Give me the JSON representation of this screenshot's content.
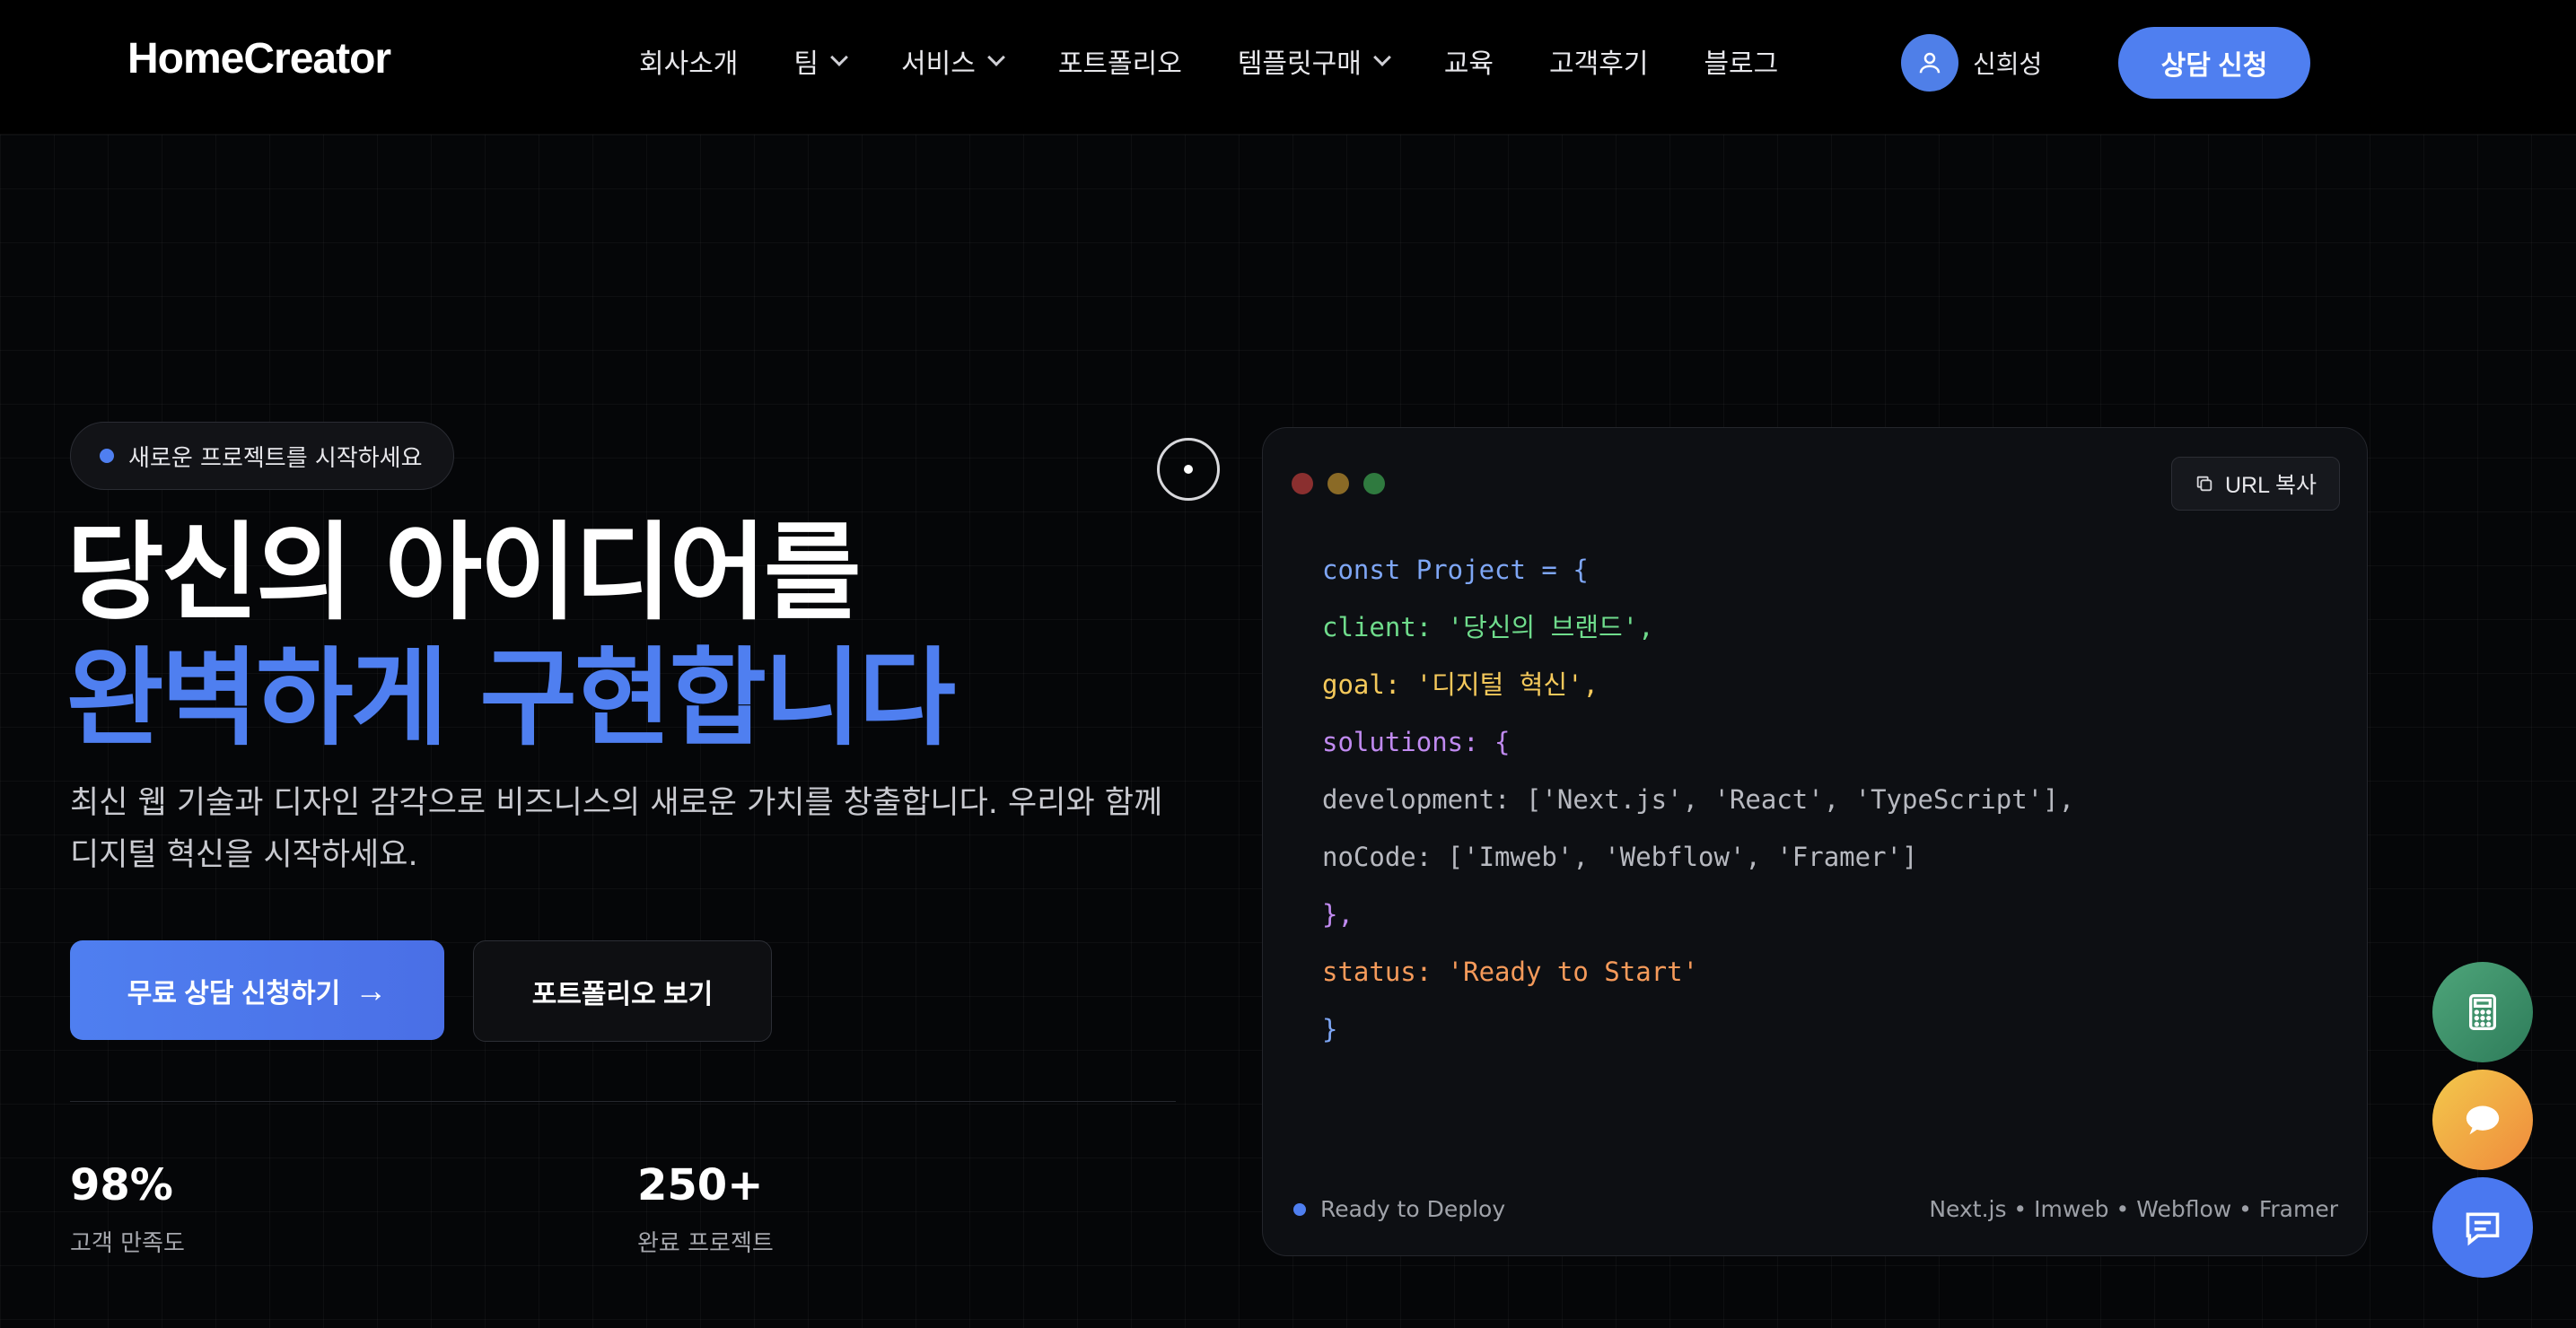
{
  "header": {
    "logo": "HomeCreator",
    "nav": [
      {
        "label": "회사소개",
        "dropdown": false
      },
      {
        "label": "팀",
        "dropdown": true
      },
      {
        "label": "서비스",
        "dropdown": true
      },
      {
        "label": "포트폴리오",
        "dropdown": false
      },
      {
        "label": "템플릿구매",
        "dropdown": true
      },
      {
        "label": "교육",
        "dropdown": false
      },
      {
        "label": "고객후기",
        "dropdown": false
      },
      {
        "label": "블로그",
        "dropdown": false
      }
    ],
    "user_name": "신희성",
    "cta": "상담 신청"
  },
  "hero": {
    "badge": "새로운 프로젝트를 시작하세요",
    "title_line1": "당신의 아이디어를",
    "title_line2": "완벽하게 구현합니다",
    "description": "최신 웹 기술과 디자인 감각으로 비즈니스의 새로운 가치를 창출합니다. 우리와 함께 디지털 혁신을 시작하세요.",
    "primary_button": "무료 상담 신청하기",
    "primary_arrow": "→",
    "secondary_button": "포트폴리오 보기",
    "stats": [
      {
        "value": "98%",
        "label": "고객 만족도"
      },
      {
        "value": "250+",
        "label": "완료 프로젝트"
      }
    ]
  },
  "code_card": {
    "copy_button": "URL 복사",
    "lines": [
      "const Project = {",
      "client: '당신의 브랜드',",
      "goal: '디지털 혁신',",
      "solutions: {",
      "development: ['Next.js', 'React', 'TypeScript'],",
      "noCode: ['Imweb', 'Webflow', 'Framer']",
      "},",
      "status: 'Ready to Start'",
      "}"
    ],
    "status": "Ready to Deploy",
    "stack": "Next.js • Imweb • Webflow • Framer"
  },
  "colors": {
    "accent": "#4f7ff0",
    "background": "#000000",
    "window_red": "#8a2f2f",
    "window_yellow": "#8a6a26",
    "window_green": "#2f7a3f"
  },
  "floating_buttons": [
    "calculator-icon",
    "chat-bubble-icon",
    "message-icon"
  ]
}
